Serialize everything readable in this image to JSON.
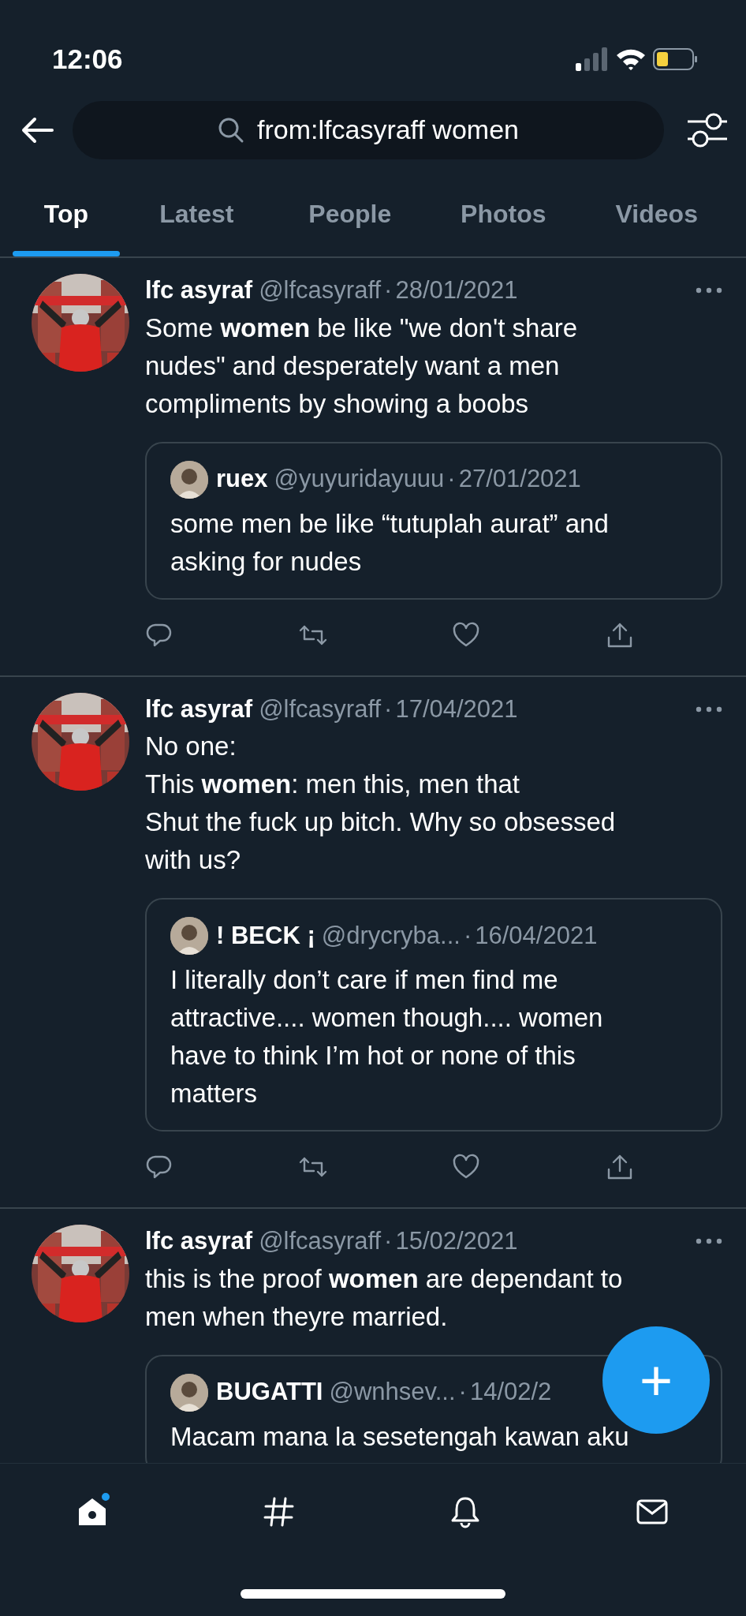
{
  "status_bar": {
    "time": "12:06"
  },
  "search": {
    "value": "from:lfcasyraff women"
  },
  "tabs": [
    {
      "label": "Top",
      "selected": true
    },
    {
      "label": "Latest",
      "selected": false
    },
    {
      "label": "People",
      "selected": false
    },
    {
      "label": "Photos",
      "selected": false
    },
    {
      "label": "Videos",
      "selected": false
    }
  ],
  "tweets": [
    {
      "name": "lfc asyraf",
      "handle": "@lfcasyraff",
      "separator": "·",
      "date": "28/01/2021",
      "text": [
        "Some **women** be like \"we don't share nudes\" and desperately want a men compliments by showing a boobs"
      ],
      "quote": {
        "name": "ruex",
        "handle": "@yuyuridayuuu",
        "separator": "·",
        "date": "27/01/2021",
        "text": "some men be like “tutuplah aurat” and asking for nudes"
      },
      "actions": true
    },
    {
      "name": "lfc asyraf",
      "handle": "@lfcasyraff",
      "separator": "·",
      "date": "17/04/2021",
      "text": [
        "No one:",
        "This **women**: men this, men that",
        "Shut the fuck up bitch. Why so obsessed with us?"
      ],
      "quote": {
        "name": "! BECK ¡",
        "handle": "@drycryba...",
        "separator": "·",
        "date": "16/04/2021",
        "text": "I literally don’t care if men find me attractive.... women though.... women have to think I’m hot or none of this matters"
      },
      "actions": true
    },
    {
      "name": "lfc asyraf",
      "handle": "@lfcasyraff",
      "separator": "·",
      "date": "15/02/2021",
      "text": [
        "this is the proof **women** are dependant to men when theyre married."
      ],
      "quote": {
        "name": "BUGATTI",
        "handle": "@wnhsev...",
        "separator": "·",
        "date": "14/02/2",
        "text": "Macam mana la sesetengah kawan aku"
      },
      "actions": false
    }
  ],
  "fab": {
    "label": "+"
  },
  "nav": [
    {
      "kind": "home",
      "selected": true,
      "badge": true
    },
    {
      "kind": "explore",
      "selected": false,
      "badge": false
    },
    {
      "kind": "notifications",
      "selected": false,
      "badge": false
    },
    {
      "kind": "messages",
      "selected": false,
      "badge": false
    }
  ]
}
